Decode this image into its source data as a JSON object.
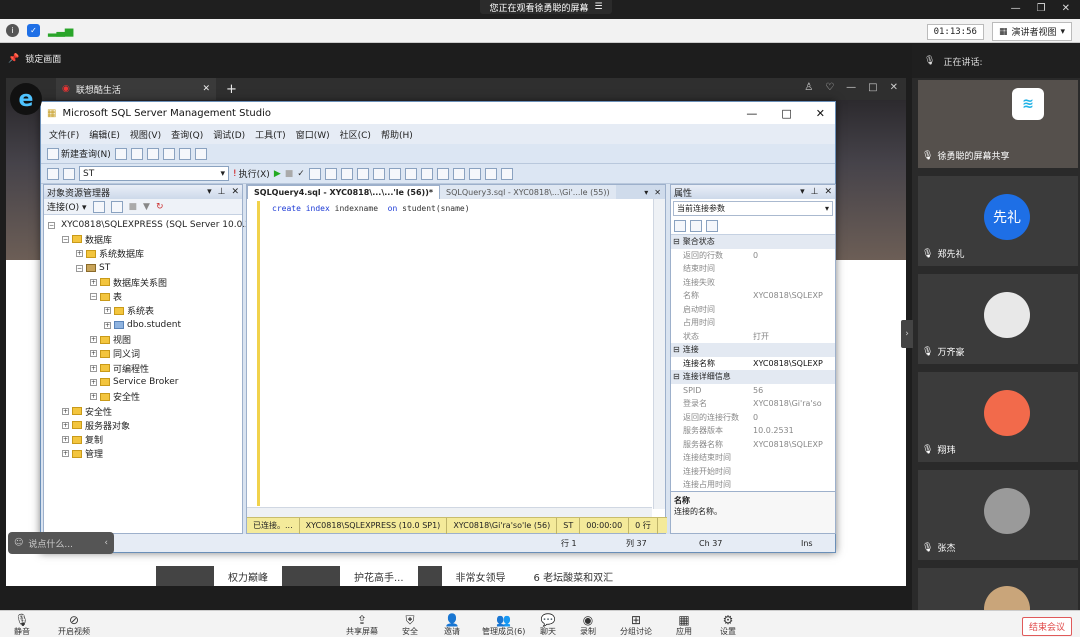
{
  "meeting": {
    "share_banner": "您正在观看徐勇聪的屏幕",
    "timer": "01:13:56",
    "view_mode": "演讲者视图",
    "lock_screen": "锁定画面",
    "speaking_label": "正在讲话:",
    "chat_placeholder": "说点什么...",
    "end_meeting": "结束会议"
  },
  "browser": {
    "tab_title": "联想酷生活",
    "bottom_items": [
      "权力巅峰",
      "护花高手...",
      "非常女领导",
      "6  老坛酸菜和双汇"
    ]
  },
  "ssms": {
    "window_title": "Microsoft SQL Server Management Studio",
    "menu": [
      "文件(F)",
      "编辑(E)",
      "视图(V)",
      "查询(Q)",
      "调试(D)",
      "工具(T)",
      "窗口(W)",
      "社区(C)",
      "帮助(H)"
    ],
    "new_query": "新建查询(N)",
    "database": "ST",
    "execute": "执行(X)",
    "object_explorer": {
      "title": "对象资源管理器",
      "connect": "连接(O) ▾",
      "tree": [
        {
          "depth": 0,
          "label": "XYC0818\\SQLEXPRESS (SQL Server 10.0.2",
          "icon": "server",
          "expanded": true
        },
        {
          "depth": 1,
          "label": "数据库",
          "icon": "folder",
          "expanded": true
        },
        {
          "depth": 2,
          "label": "系统数据库",
          "icon": "folder",
          "expanded": false
        },
        {
          "depth": 2,
          "label": "ST",
          "icon": "db",
          "expanded": true
        },
        {
          "depth": 3,
          "label": "数据库关系图",
          "icon": "folder",
          "expanded": false
        },
        {
          "depth": 3,
          "label": "表",
          "icon": "folder",
          "expanded": true
        },
        {
          "depth": 4,
          "label": "系统表",
          "icon": "folder",
          "expanded": false
        },
        {
          "depth": 4,
          "label": "dbo.student",
          "icon": "table",
          "expanded": false
        },
        {
          "depth": 3,
          "label": "视图",
          "icon": "folder",
          "expanded": false
        },
        {
          "depth": 3,
          "label": "同义词",
          "icon": "folder",
          "expanded": false
        },
        {
          "depth": 3,
          "label": "可编程性",
          "icon": "folder",
          "expanded": false
        },
        {
          "depth": 3,
          "label": "Service Broker",
          "icon": "folder",
          "expanded": false
        },
        {
          "depth": 3,
          "label": "安全性",
          "icon": "folder",
          "expanded": false
        },
        {
          "depth": 1,
          "label": "安全性",
          "icon": "folder",
          "expanded": false
        },
        {
          "depth": 1,
          "label": "服务器对象",
          "icon": "folder",
          "expanded": false
        },
        {
          "depth": 1,
          "label": "复制",
          "icon": "folder",
          "expanded": false
        },
        {
          "depth": 1,
          "label": "管理",
          "icon": "folder",
          "expanded": false
        }
      ]
    },
    "query": {
      "tab_active": "SQLQuery4.sql - XYC0818\\...\\...'le (56))*",
      "tab_inactive": "SQLQuery3.sql - XYC0818\\...\\Gi'...le (55))",
      "code_kw1": "create",
      "code_kw2": "index",
      "code_ident": "indexname",
      "code_kw3": "on",
      "code_table": "student",
      "code_args": "(sname)",
      "status": [
        "已连接。...",
        "XYC0818\\SQLEXPRESS (10.0 SP1)",
        "XYC0818\\Gi'ra'so'le (56)",
        "ST",
        "00:00:00",
        "0 行"
      ]
    },
    "properties": {
      "title": "属性",
      "selector": "当前连接参数",
      "sections": [
        {
          "name": "聚合状态",
          "rows": [
            [
              "返回的行数",
              "0",
              false
            ],
            [
              "结束时间",
              "",
              false
            ],
            [
              "连接失败",
              "",
              false
            ],
            [
              "名称",
              "XYC0818\\SQLEXP",
              false
            ],
            [
              "启动时间",
              "",
              false
            ],
            [
              "占用时间",
              "",
              false
            ],
            [
              "状态",
              "打开",
              false
            ]
          ]
        },
        {
          "name": "连接",
          "rows": [
            [
              "连接名称",
              "XYC0818\\SQLEXP",
              true
            ]
          ]
        },
        {
          "name": "连接详细信息",
          "rows": [
            [
              "SPID",
              "56",
              false
            ],
            [
              "登录名",
              "XYC0818\\Gi'ra'so",
              false
            ],
            [
              "返回的连接行数",
              "0",
              false
            ],
            [
              "服务器版本",
              "10.0.2531",
              false
            ],
            [
              "服务器名称",
              "XYC0818\\SQLEXP",
              false
            ],
            [
              "连接结束时间",
              "",
              false
            ],
            [
              "连接开始时间",
              "",
              false
            ],
            [
              "连接占用时间",
              "",
              false
            ]
          ]
        }
      ],
      "desc_title": "名称",
      "desc_text": "连接的名称。"
    },
    "statusbar": {
      "line": "行 1",
      "col": "列 37",
      "ch": "Ch 37",
      "ins": "Ins"
    }
  },
  "participants": [
    {
      "name": "徐勇聪的屏幕共享",
      "avatar_text": "",
      "color": "#8a8a8a"
    },
    {
      "name": "郑先礼",
      "avatar_text": "先礼",
      "color": "#1e6fe6"
    },
    {
      "name": "万齐豪",
      "avatar_text": "",
      "color": "#e8e8e8"
    },
    {
      "name": "翔玮",
      "avatar_text": "",
      "color": "#f26a4b"
    },
    {
      "name": "张杰",
      "avatar_text": "",
      "color": "#9a9a9a"
    },
    {
      "name": "",
      "avatar_text": "",
      "color": "#c9a57a"
    }
  ],
  "bottom_bar": [
    "静音",
    "开启视频",
    "共享屏幕",
    "安全",
    "邀请",
    "管理成员(6)",
    "聊天",
    "录制",
    "分组讨论",
    "应用",
    "设置"
  ]
}
